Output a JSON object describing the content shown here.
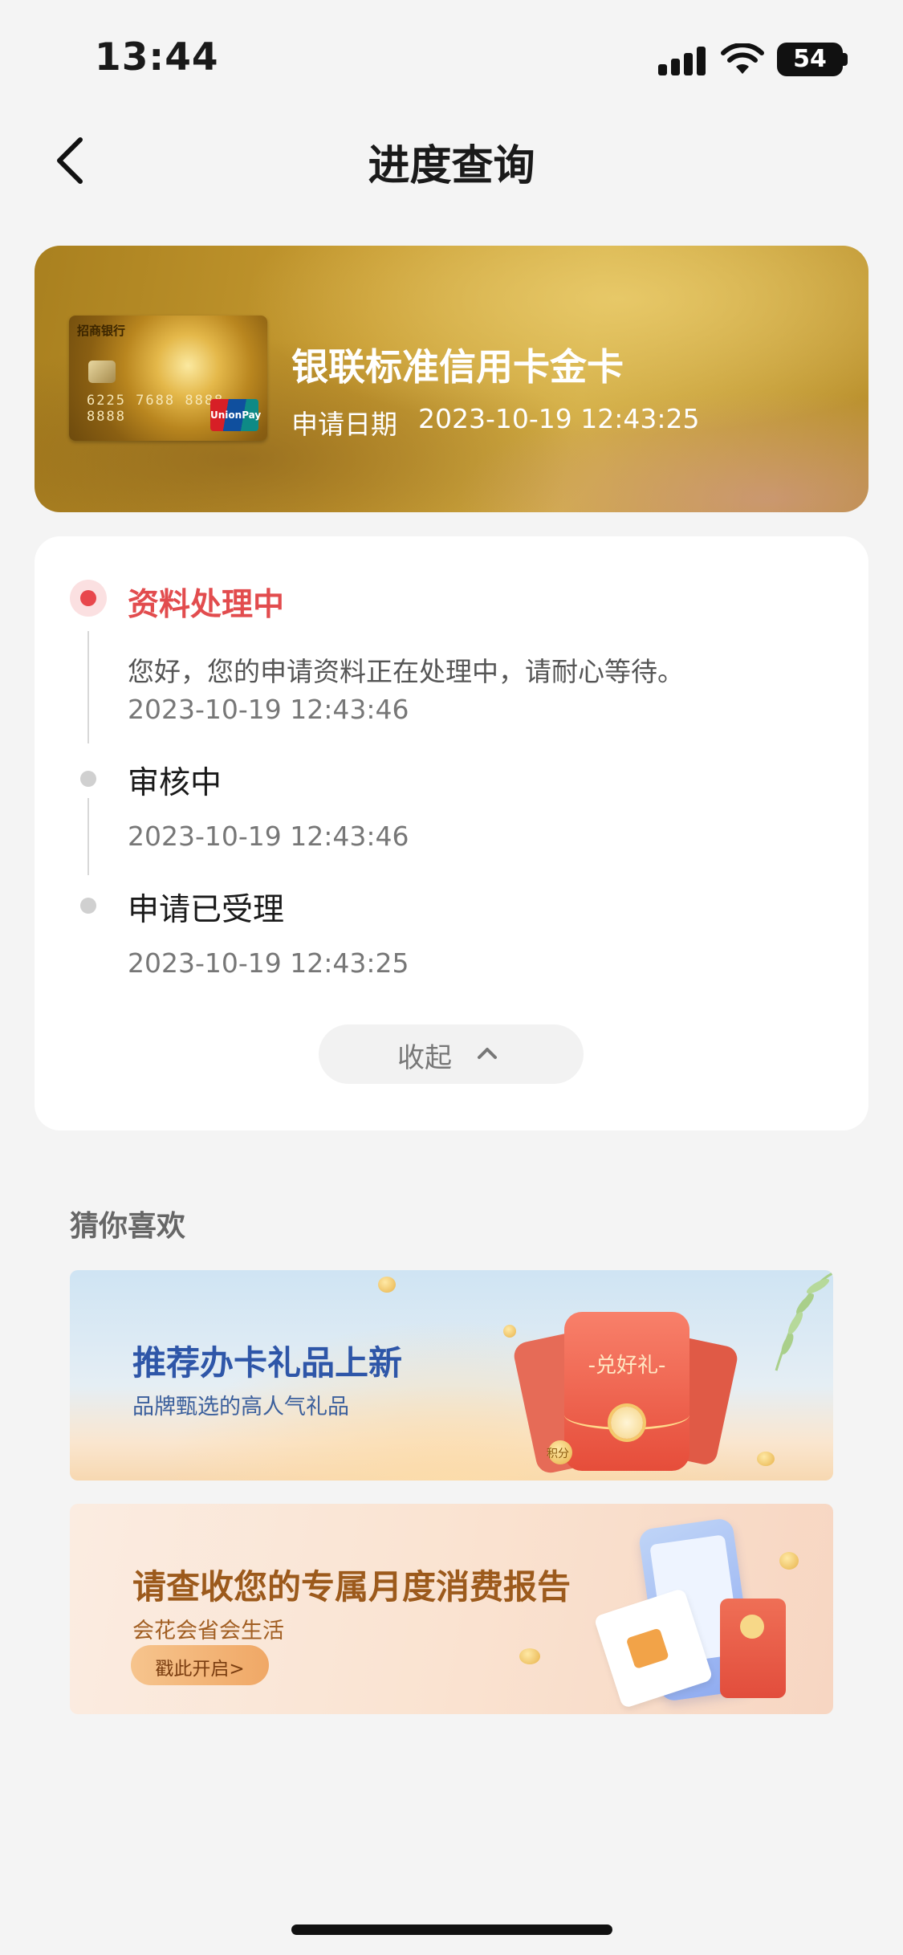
{
  "status_bar": {
    "time": "13:44",
    "battery": "54"
  },
  "nav": {
    "title": "进度查询"
  },
  "card": {
    "bank_label": "招商银行",
    "card_number": "6225 7688 8888 8888",
    "network_label": "UnionPay",
    "name": "银联标准信用卡金卡",
    "apply_label": "申请日期",
    "apply_date": "2023-10-19 12:43:25"
  },
  "progress": {
    "steps": [
      {
        "title": "资料处理中",
        "desc": "您好，您的申请资料正在处理中，请耐心等待。",
        "time": "2023-10-19 12:43:46",
        "active": true
      },
      {
        "title": "审核中",
        "time": "2023-10-19 12:43:46",
        "active": false
      },
      {
        "title": "申请已受理",
        "time": "2023-10-19 12:43:25",
        "active": false
      }
    ],
    "collapse_label": "收起"
  },
  "recommend": {
    "title": "猜你喜欢",
    "banners": [
      {
        "title": "推荐办卡礼品上新",
        "subtitle": "品牌甄选的高人气礼品",
        "badge": "-兑好礼-",
        "coin_label": "积分"
      },
      {
        "title": "请查收您的专属月度消费报告",
        "subtitle": "会花会省会生活",
        "button": "戳此开启>"
      }
    ]
  },
  "colors": {
    "accent_red": "#e24c4e",
    "gold": "#c69a30",
    "background": "#f4f4f4"
  }
}
